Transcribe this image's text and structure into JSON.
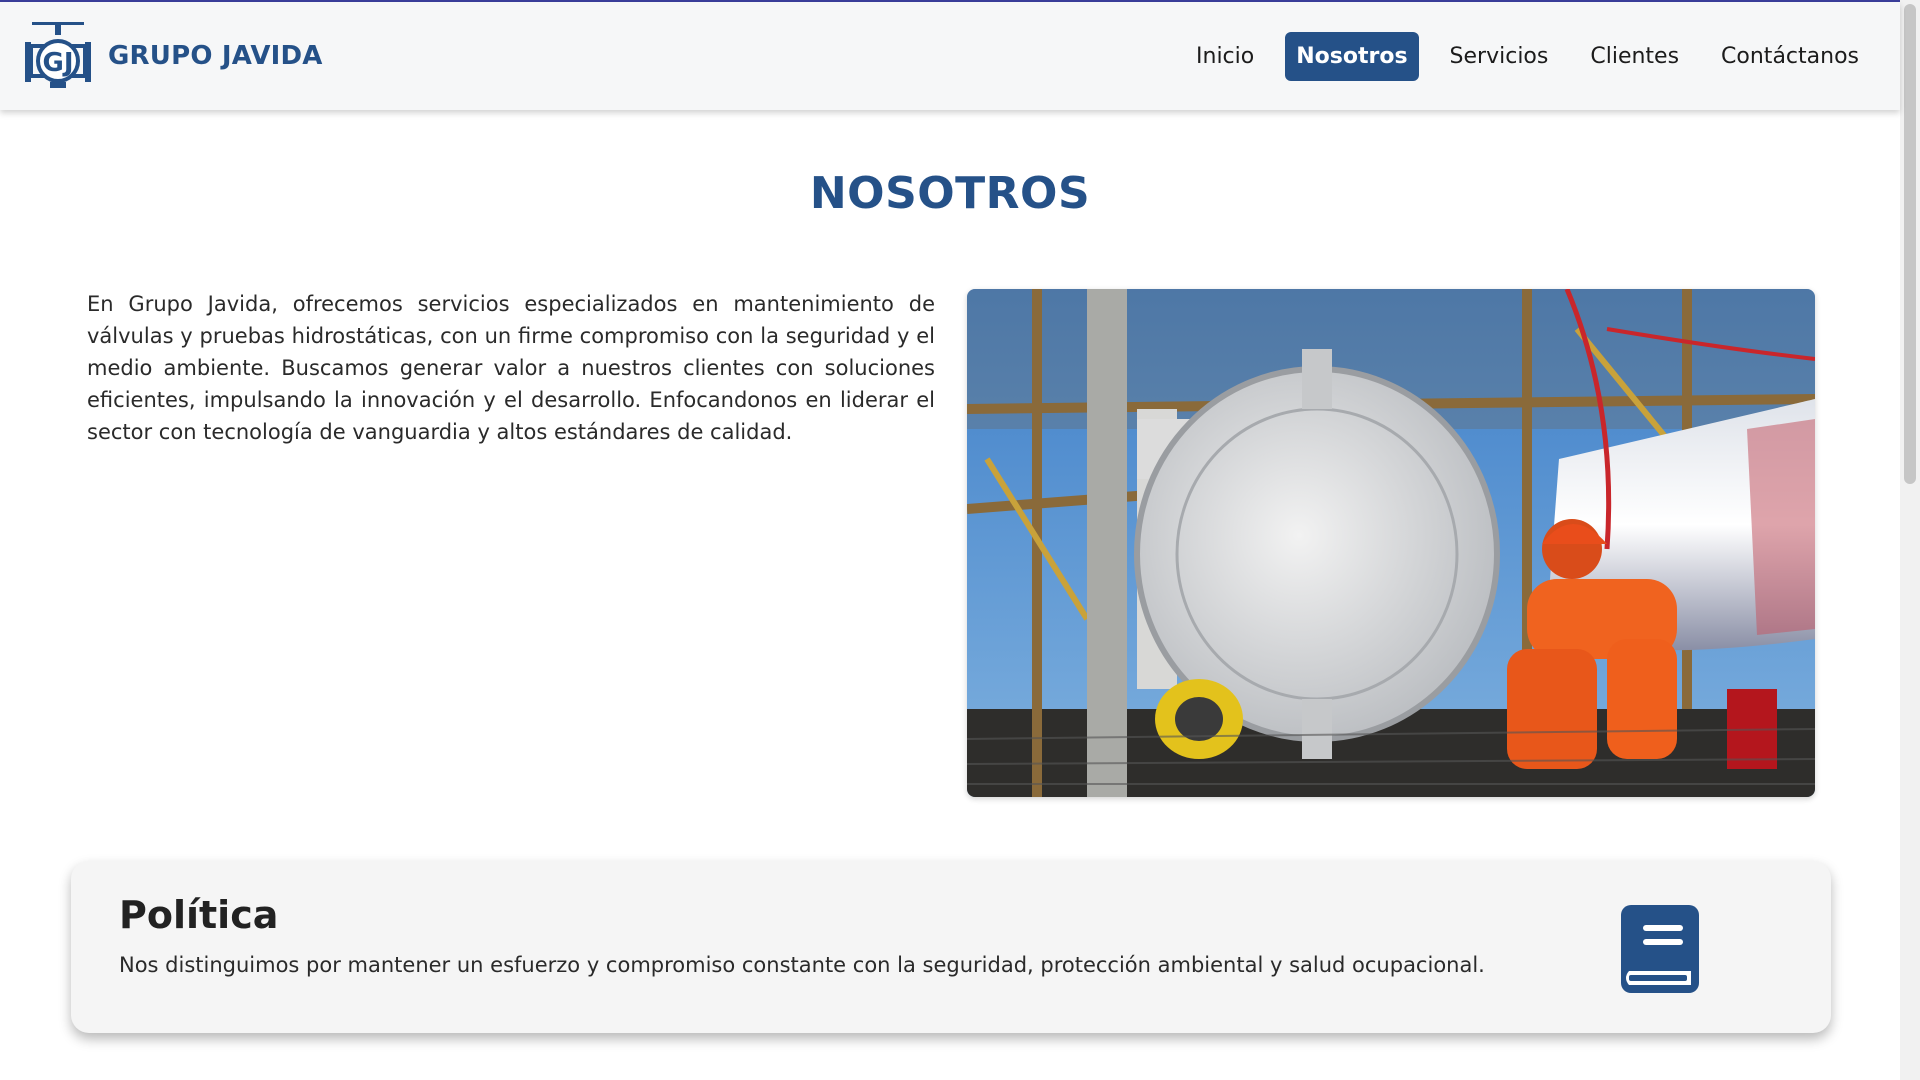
{
  "brand": {
    "name": "GRUPO JAVIDA",
    "logo_icon": "gj-valve-logo-icon",
    "color": "#255188"
  },
  "nav": {
    "items": [
      {
        "label": "Inicio",
        "active": false
      },
      {
        "label": "Nosotros",
        "active": true
      },
      {
        "label": "Servicios",
        "active": false
      },
      {
        "label": "Clientes",
        "active": false
      },
      {
        "label": "Contáctanos",
        "active": false
      }
    ]
  },
  "about": {
    "title": "NOSOTROS",
    "text": "En Grupo Javida, ofrecemos servicios especializados en mantenimiento de válvulas y pruebas hidrostáticas, con un firme compromiso con la seguridad y el medio ambiente. Buscamos generar valor a nuestros clientes con soluciones eficientes, impulsando la innovación y el desarrollo. Enfocandonos en liderar el sector con tecnología de vanguardia y altos estándares de calidad.",
    "image": "offshore-pipeline-worker-photo"
  },
  "policy": {
    "title": "Política",
    "text": "Nos distinguimos por mantener un esfuerzo y compromiso constante con la seguridad, protección ambiental y salud ocupacional.",
    "icon": "book-icon"
  }
}
